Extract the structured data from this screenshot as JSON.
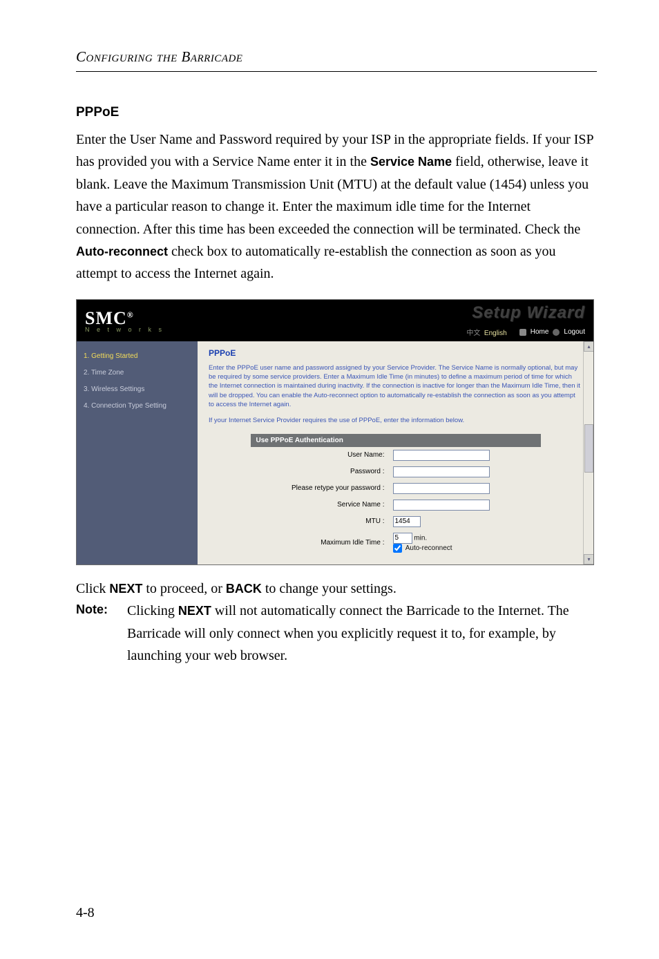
{
  "running_head": "Configuring the Barricade",
  "section_title": "PPPoE",
  "body_html_parts": {
    "p1a": "Enter the User Name and Password required by your ISP in the appropriate fields. If your ISP has provided you with a Service Name enter it in the ",
    "p1b": "Service Name",
    "p1c": " field, otherwise, leave it blank. Leave the Maximum Transmission Unit (MTU) at the default value (1454) unless you have a particular reason to change it. Enter the maximum idle time for the Internet connection. After this time has been exceeded the connection will be terminated. Check the ",
    "p1d": "Auto-reconnect",
    "p1e": " check box to automatically re-establish the connection as soon as you attempt to access the Internet again."
  },
  "after_shot": {
    "a": "Click ",
    "b": "NEXT",
    "c": " to proceed, or ",
    "d": "BACK",
    "e": " to change your settings."
  },
  "note": {
    "label": "Note:",
    "a": "Clicking ",
    "b": "NEXT",
    "c": " will not automatically connect the Barricade to the Internet. The Barricade will only connect when you explicitly request it to, for example, by launching your web browser."
  },
  "page_num": "4-8",
  "shot": {
    "logo": "SMC",
    "logo_reg": "®",
    "logo_sub": "N e t w o r k s",
    "wizard": "Setup Wizard",
    "lang_cn": "中文",
    "lang_en": "English",
    "btn_home": "Home",
    "btn_logout": "Logout",
    "sidebar": {
      "s1": "1. Getting Started",
      "s2": "2. Time Zone",
      "s3": "3. Wireless Settings",
      "s4": "4. Connection Type Setting"
    },
    "content": {
      "title": "PPPoE",
      "blurb": "Enter the PPPoE user name and password assigned by your Service Provider. The Service Name is normally optional, but may be required by some service providers. Enter a Maximum Idle Time (in minutes) to define a maximum period of time for which the Internet connection is maintained during inactivity. If the connection is inactive for longer than the Maximum Idle Time, then it will be dropped. You can enable the Auto-reconnect option to automatically re-establish the connection as soon as you attempt to access the Internet again.",
      "blurb2": "If your Internet Service Provider requires the use of PPPoE, enter the information below.",
      "table_header": "Use PPPoE Authentication",
      "row_user": "User Name:",
      "row_pass": "Password :",
      "row_retype": "Please retype your password :",
      "row_service": "Service Name :",
      "row_mtu": "MTU :",
      "mtu_value": "1454",
      "row_idle": "Maximum Idle Time :",
      "idle_value": "5",
      "idle_unit": "min.",
      "auto_label": "Auto-reconnect"
    }
  }
}
